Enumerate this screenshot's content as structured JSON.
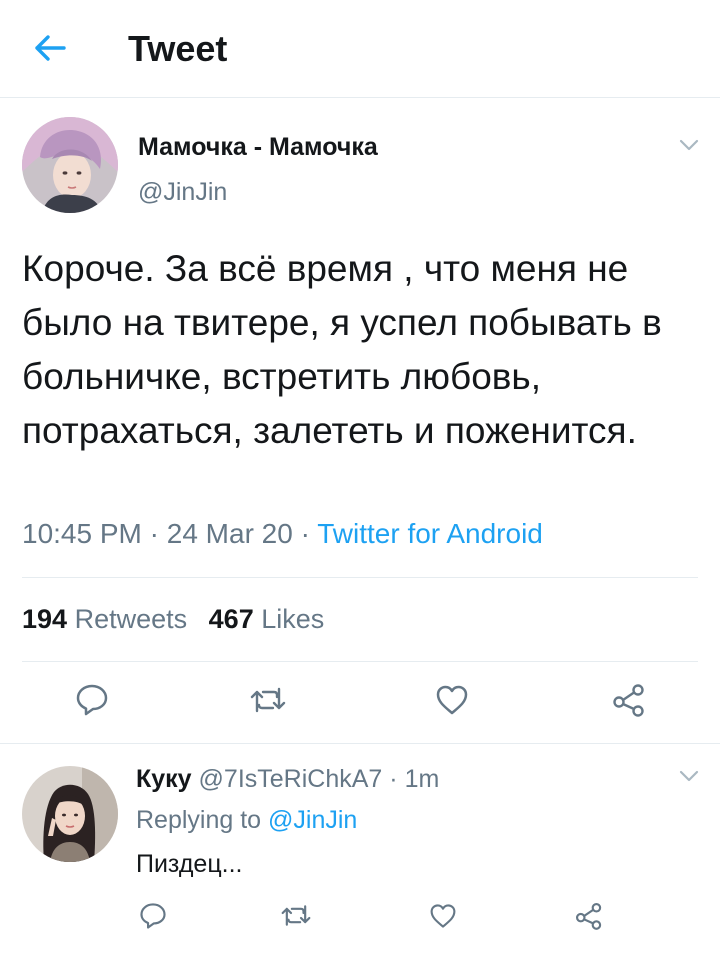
{
  "header": {
    "title": "Tweet"
  },
  "tweet": {
    "author_name": "Мамочка - Мамочка",
    "author_handle": "@JinJin",
    "text": "Короче. За всё время , что меня не было на твитере, я успел побывать в больничке, встретить любовь, потрахаться, залететь и поженится.",
    "time": "10:45 PM",
    "date": "24 Mar 20",
    "sep": "·",
    "source": "Twitter for Android",
    "retweets_count": "194",
    "retweets_label": "Retweets",
    "likes_count": "467",
    "likes_label": "Likes"
  },
  "reply": {
    "name": "Куку",
    "handle": "@7IsTeRiChkA7",
    "sep": "·",
    "time": "1m",
    "replying_prefix": "Replying to",
    "replying_mention": "@JinJin",
    "text": "Пиздец..."
  },
  "icons": {
    "back": "arrow-left-icon",
    "caret": "chevron-down-icon",
    "reply": "reply-icon",
    "retweet": "retweet-icon",
    "like": "heart-icon",
    "share": "share-icon"
  },
  "colors": {
    "accent": "#1da1f2",
    "secondary_text": "#657786",
    "primary_text": "#14171a",
    "divider": "#e6ecf0",
    "icon_gray": "#657786"
  }
}
